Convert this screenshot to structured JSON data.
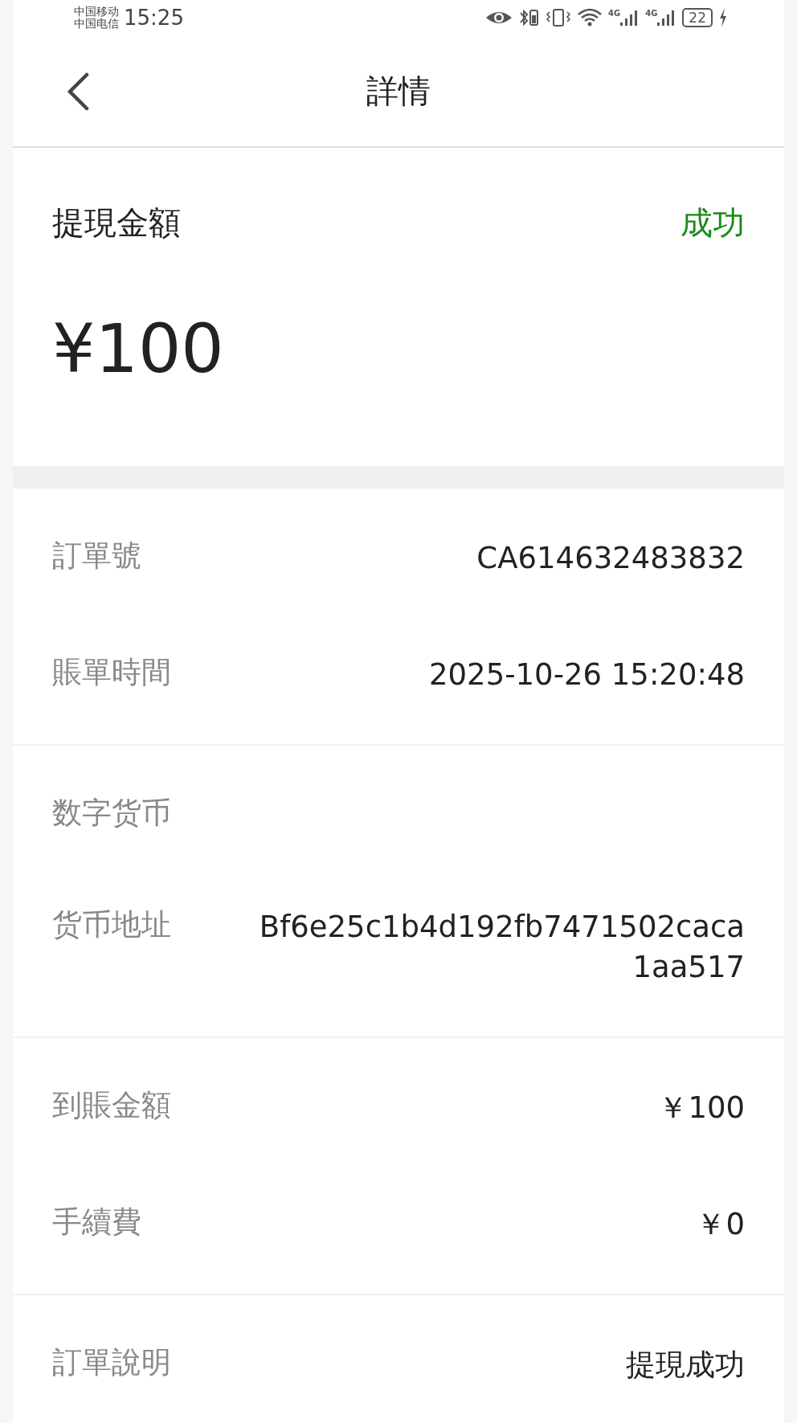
{
  "status_bar": {
    "carriers": [
      "中国移动",
      "中国电信"
    ],
    "time": "15:25",
    "network_labels": [
      "4G",
      "4G"
    ],
    "battery": "22"
  },
  "header": {
    "title": "詳情"
  },
  "summary": {
    "label": "提現金額",
    "status": "成功",
    "success": true,
    "amount": "¥100"
  },
  "groups": [
    [
      {
        "label": "訂單號",
        "value": "CA614632483832"
      },
      {
        "label": "賬單時間",
        "value": "2025-10-26 15:20:48"
      }
    ],
    [
      {
        "label": "数字货币"
      },
      {
        "label": "货币地址",
        "value": "Bf6e25c1b4d192fb7471502caca1aa517"
      }
    ],
    [
      {
        "label": "到賬金額",
        "value": "￥100"
      },
      {
        "label": "手續費",
        "value": "￥0"
      }
    ],
    [
      {
        "label": "訂單說明",
        "value": "提現成功"
      }
    ]
  ]
}
